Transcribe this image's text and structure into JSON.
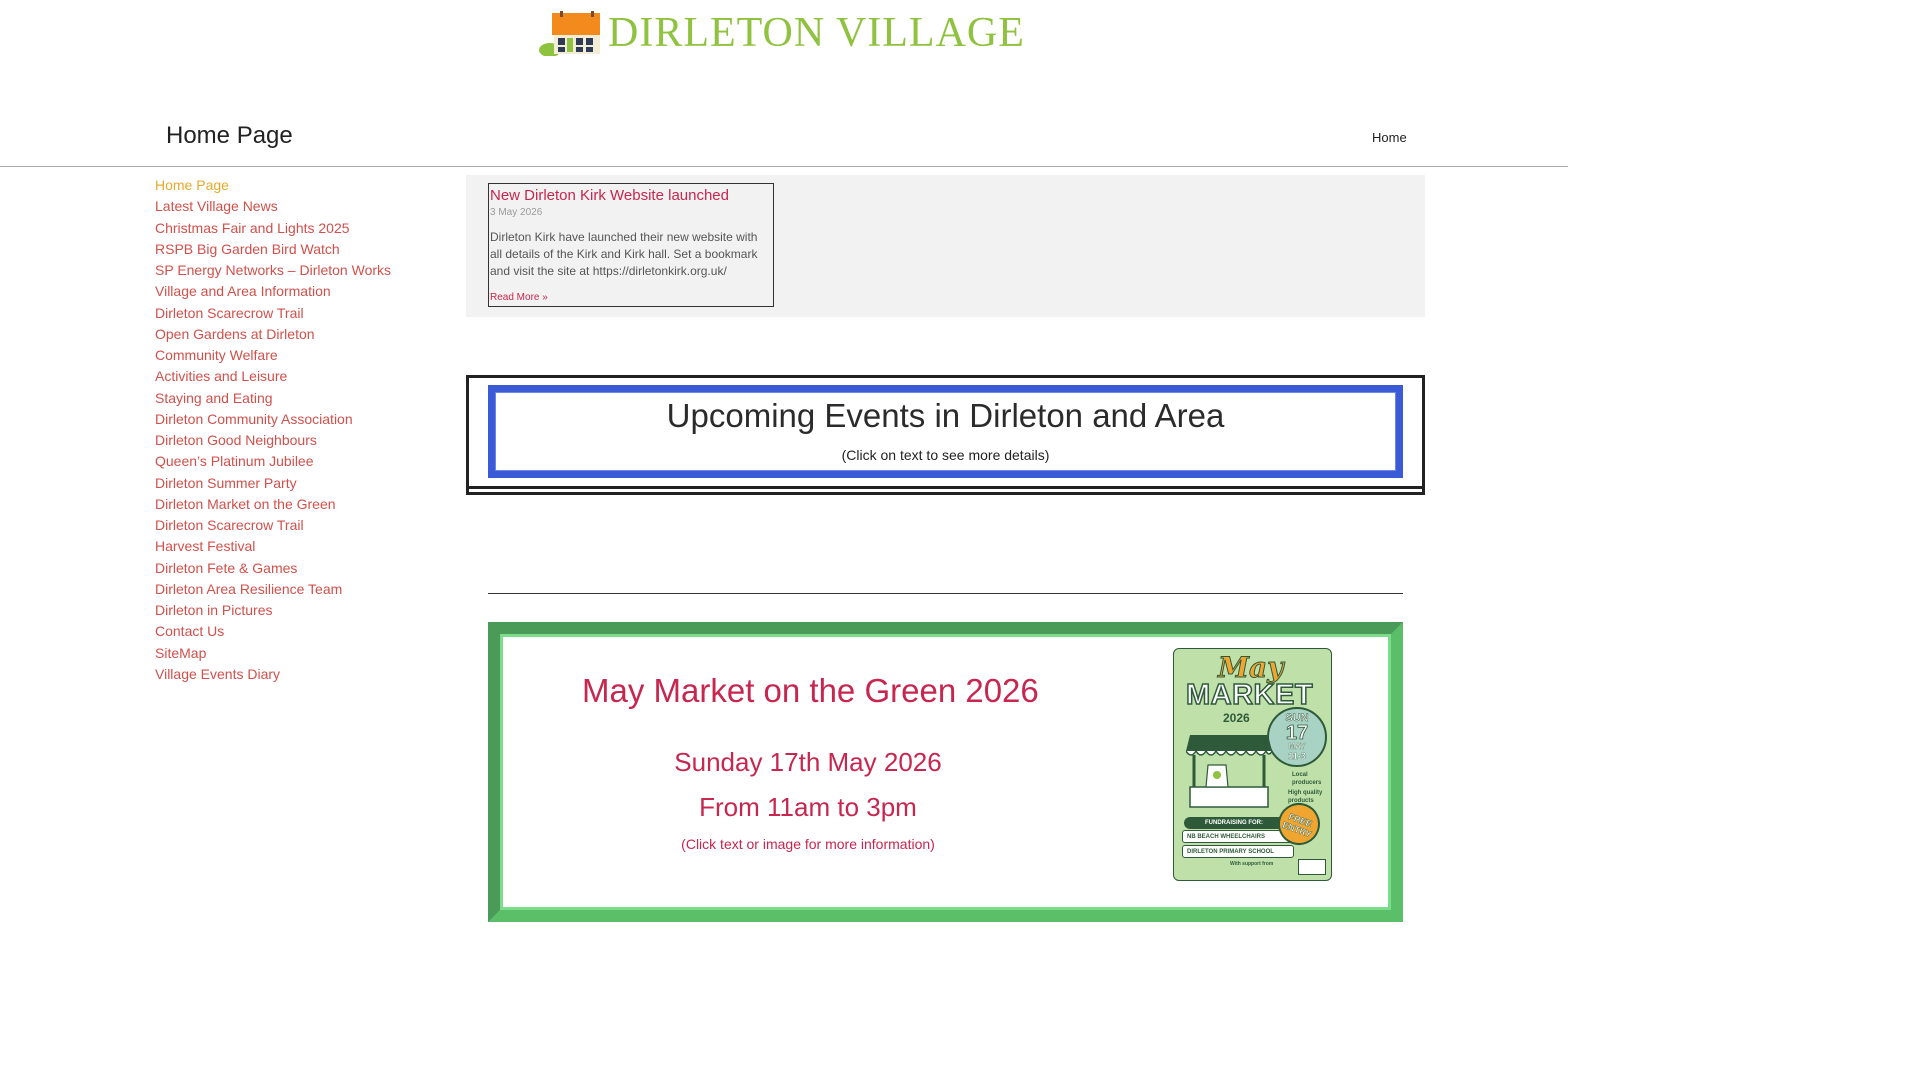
{
  "site": {
    "name": "DIRLETON VILLAGE",
    "logo_icon": "cottage-logo-icon"
  },
  "header": {
    "page_title": "Home Page",
    "top_nav_home": "Home"
  },
  "sidebar": {
    "items": [
      {
        "label": "Home Page",
        "active": true
      },
      {
        "label": "Latest Village News"
      },
      {
        "label": "Christmas Fair and Lights 2025"
      },
      {
        "label": "RSPB Big Garden Bird Watch"
      },
      {
        "label": "SP Energy Networks – Dirleton Works"
      },
      {
        "label": "Village and Area Information"
      },
      {
        "label": "Dirleton Scarecrow Trail"
      },
      {
        "label": "Open Gardens at Dirleton"
      },
      {
        "label": "Community Welfare"
      },
      {
        "label": "Activities and Leisure"
      },
      {
        "label": "Staying and Eating"
      },
      {
        "label": "Dirleton Community Association"
      },
      {
        "label": "Dirleton Good Neighbours"
      },
      {
        "label": "Queen’s Platinum Jubilee"
      },
      {
        "label": "Dirleton Summer Party"
      },
      {
        "label": "Dirleton Market on the Green"
      },
      {
        "label": "Dirleton Scarecrow Trail"
      },
      {
        "label": "Harvest Festival"
      },
      {
        "label": "Dirleton Fete & Games"
      },
      {
        "label": "Dirleton Area Resilience Team"
      },
      {
        "label": "Dirleton in Pictures"
      },
      {
        "label": "Contact Us"
      },
      {
        "label": "SiteMap"
      },
      {
        "label": "Village Events Diary"
      }
    ]
  },
  "news": {
    "title": "New Dirleton Kirk Website launched",
    "date": "3 May 2026",
    "body": "Dirleton Kirk have launched their new website with all details of the Kirk and Kirk hall. Set a bookmark and visit the site at https://dirletonkirk.org.uk/",
    "read_more": "Read More »"
  },
  "events": {
    "heading": "Upcoming Events in Dirleton and Area",
    "subheading": "(Click on text to see more details)"
  },
  "market": {
    "title": "May Market on the Green 2026",
    "date": "Sunday 17th May 2026",
    "time": "From 11am to 3pm",
    "note": "(Click text or image for more information)",
    "poster": {
      "may": "May",
      "market": "MARKET",
      "year": "2026",
      "badge_day": "SUN",
      "badge_date": "17",
      "badge_month": "MAY",
      "badge_time": "11-3",
      "note1": "Local producers",
      "note2": "High quality products",
      "fundraising": "FUNDRAISING FOR:",
      "org1": "NB BEACH WHEELCHAIRS",
      "org2": "DIRLETON PRIMARY SCHOOL",
      "free_entry": "FREE ENTRY",
      "support": "With support from"
    }
  },
  "colors": {
    "link": "#d1504b",
    "active_link": "#e8a92a",
    "accent": "#c7264f",
    "logo_green": "#8fc23f",
    "events_border": "#3b5bd6",
    "market_border": "#5bbf6a"
  }
}
